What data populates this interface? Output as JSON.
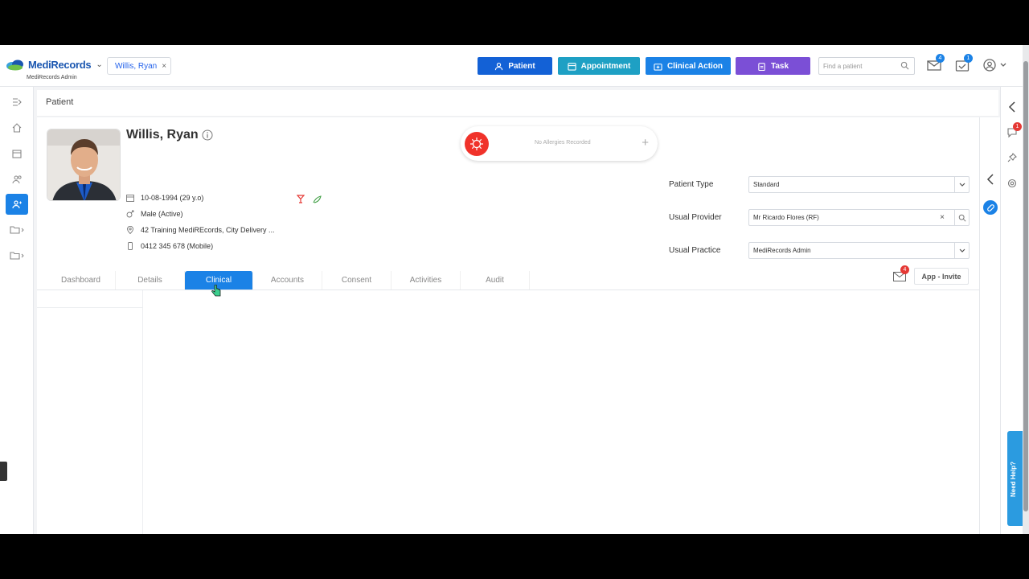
{
  "brand": {
    "name": "MediRecords",
    "sub": "MediRecords Admin"
  },
  "open_tab": {
    "label": "Willis, Ryan",
    "close": "×"
  },
  "header_buttons": [
    {
      "label": "Patient",
      "color": "#1361d6"
    },
    {
      "label": "Appointment",
      "color": "#1ea0c4"
    },
    {
      "label": "Clinical Action",
      "color": "#1b82e6"
    },
    {
      "label": "Task",
      "color": "#7b4fd6"
    }
  ],
  "search": {
    "placeholder": "Find a patient"
  },
  "mail_badge": "4",
  "tasks_badge": "1",
  "page": {
    "title": "Patient"
  },
  "patient": {
    "name": "Willis, Ryan",
    "dob": "10-08-1994 (29 y.o)",
    "gender": "Male (Active)",
    "address": "42 Training MediREcords, City Delivery ...",
    "phone": "0412 345 678 (Mobile)"
  },
  "allergy": {
    "text": "No Allergies Recorded",
    "add": "+"
  },
  "fields": [
    {
      "label": "Patient Type",
      "value": "Standard"
    },
    {
      "label": "Usual Provider",
      "value": "Mr Ricardo Flores (RF)"
    },
    {
      "label": "Usual Practice",
      "value": "MediRecords Admin"
    }
  ],
  "tabs": [
    "Dashboard",
    "Details",
    "Clinical",
    "Accounts",
    "Consent",
    "Activities",
    "Audit"
  ],
  "active_tab": "Clinical",
  "app_invite": {
    "label": "App - Invite",
    "badge": "4"
  },
  "notif_badge": "1",
  "need_help": "Need Help?"
}
